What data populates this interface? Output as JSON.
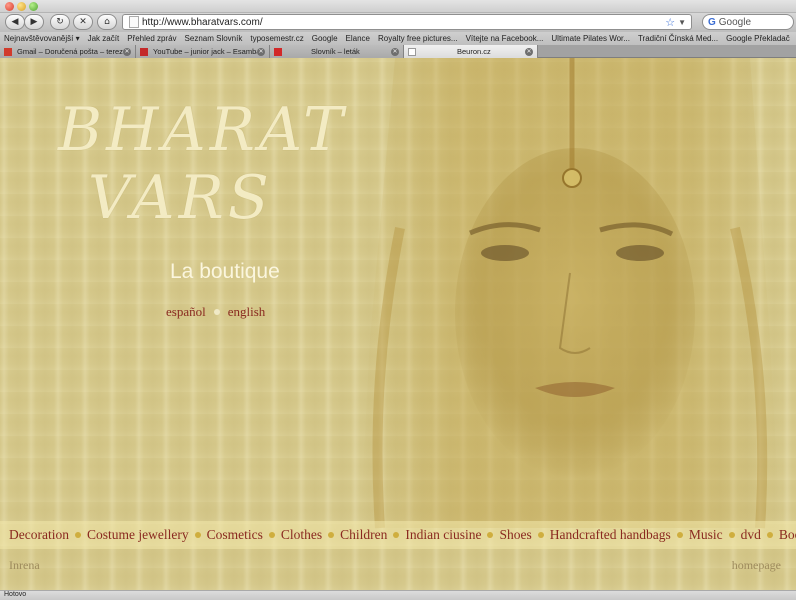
{
  "browser": {
    "url": "http://www.bharatvars.com/",
    "search_placeholder": "Google",
    "status": "Hotovo",
    "bookmarks": [
      "Nejnavštěvovanější ▾",
      "Jak začít",
      "Přehled zpráv",
      "Seznam Slovník",
      "typosemestr.cz",
      "Google",
      "Elance",
      "Royalty free pictures...",
      "Vítejte na Facebook...",
      "Ultimate Pilates Wor...",
      "Tradiční Čínská Med...",
      "Google Překladač"
    ],
    "tabs": [
      {
        "title": "Gmail – Doručená pošta – terez...",
        "favicon": "gmail-icon",
        "color": "#d13b2c",
        "active": false
      },
      {
        "title": "YouTube – junior jack – Esamba",
        "favicon": "youtube-icon",
        "color": "#c42a2a",
        "active": false
      },
      {
        "title": "Slovník – leták",
        "favicon": "seznam-icon",
        "color": "#d22828",
        "active": false
      },
      {
        "title": "Beuron.cz",
        "favicon": "page-icon",
        "color": "#ffffff",
        "active": true
      }
    ],
    "icons": {
      "back": "back-arrow-icon",
      "forward": "forward-arrow-icon",
      "reload": "reload-icon",
      "stop": "stop-icon",
      "home": "home-icon",
      "bookmark_star": "star-icon",
      "search_engine": "google-icon"
    }
  },
  "page": {
    "logo_line1": "BHARAT",
    "logo_line2": "VARS",
    "tagline": "La boutique",
    "languages": [
      "español",
      "english"
    ],
    "menu": [
      "Decoration",
      "Costume jewellery",
      "Cosmetics",
      "Clothes",
      "Children",
      "Indian ciusine",
      "Shoes",
      "Handcrafted handbags",
      "Music",
      "dvd",
      "Books"
    ],
    "footer_left": "Inrena",
    "footer_right": "homepage",
    "colors": {
      "background": "#d6c98c",
      "link": "#8a2a20",
      "logo": "#f3ebc3",
      "menu_dot": "#cfae3e"
    }
  }
}
